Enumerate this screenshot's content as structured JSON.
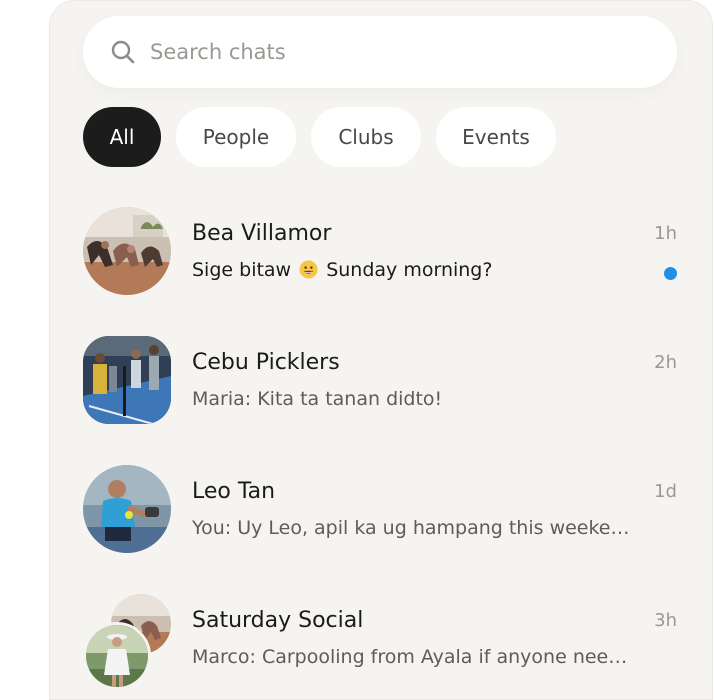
{
  "search": {
    "placeholder": "Search chats",
    "value": ""
  },
  "filters": [
    {
      "label": "All",
      "active": true
    },
    {
      "label": "People",
      "active": false
    },
    {
      "label": "Clubs",
      "active": false
    },
    {
      "label": "Events",
      "active": false
    }
  ],
  "chats": [
    {
      "name": "Bea Villamor",
      "time": "1h",
      "preview_before": "Sige bitaw",
      "preview_emoji": "grinning-face-emoji",
      "preview_after": "Sunday morning?",
      "unread": true,
      "avatar": "photo-yoga-group"
    },
    {
      "name": "Cebu Picklers",
      "time": "2h",
      "preview": "Maria: Kita ta tanan didto!",
      "unread": false,
      "avatar": "photo-pickleball-court"
    },
    {
      "name": "Leo Tan",
      "time": "1d",
      "preview": "You: Uy Leo, apil ka ug hampang this weeke…",
      "unread": false,
      "avatar": "photo-player-swing"
    },
    {
      "name": "Saturday Social",
      "time": "3h",
      "preview": "Marco: Carpooling from Ayala if anyone nee…",
      "unread": false,
      "avatar": "photo-group-stack"
    }
  ],
  "colors": {
    "panel_bg": "#f6f4f1",
    "active_chip": "#1c1c1c",
    "unread_dot": "#1f8fe8",
    "muted_text": "#9b9893"
  }
}
